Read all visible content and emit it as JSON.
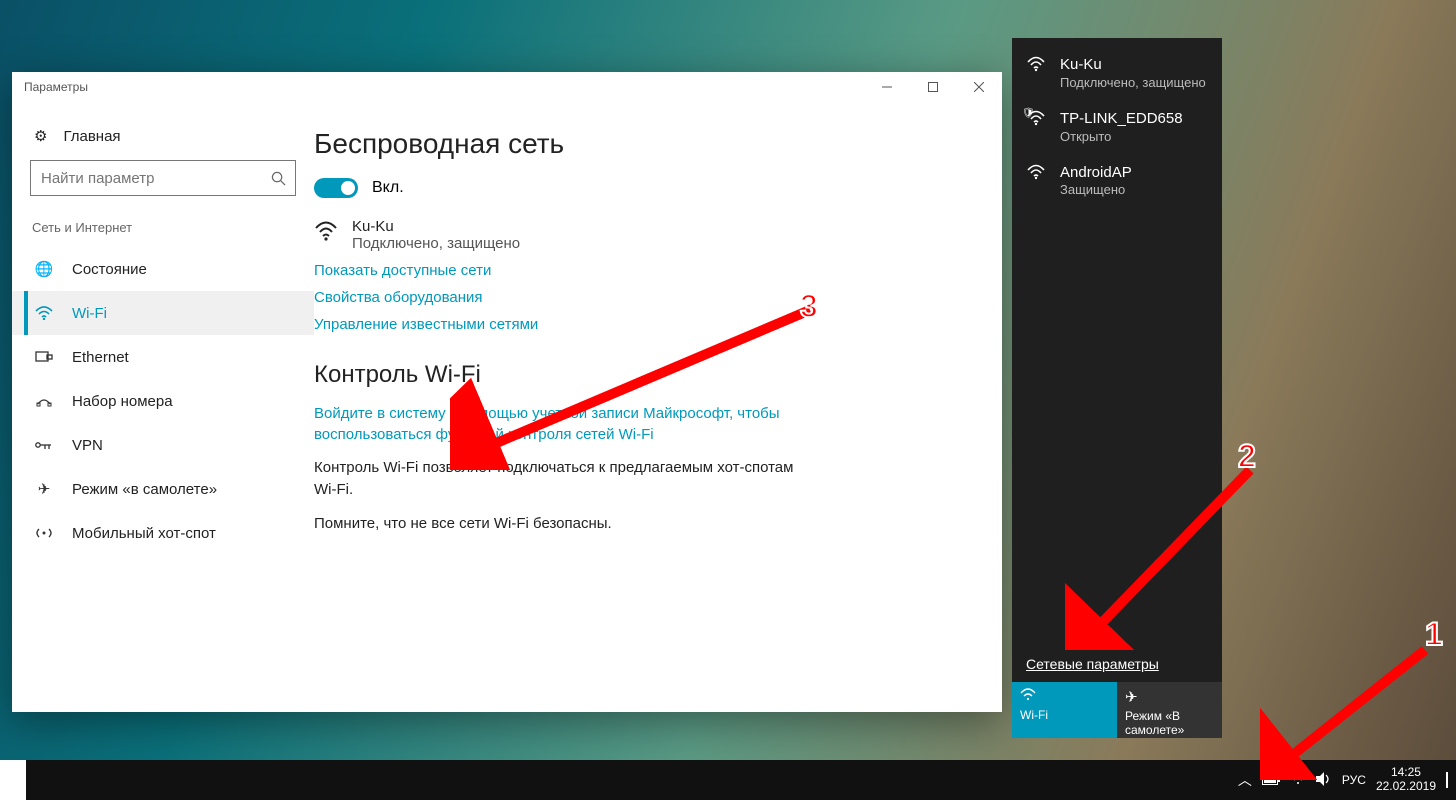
{
  "settings": {
    "window_title": "Параметры",
    "home_label": "Главная",
    "search_placeholder": "Найти параметр",
    "section_label": "Сеть и Интернет",
    "nav": {
      "status": "Состояние",
      "wifi": "Wi-Fi",
      "ethernet": "Ethernet",
      "dialup": "Набор номера",
      "vpn": "VPN",
      "airplane": "Режим «в самолете»",
      "hotspot": "Мобильный хот-спот"
    },
    "content": {
      "h1": "Беспроводная сеть",
      "toggle_label": "Вкл.",
      "net_name": "Ku-Ku",
      "net_status": "Подключено, защищено",
      "link_available": "Показать доступные сети",
      "link_hardware": "Свойства оборудования",
      "link_known": "Управление известными сетями",
      "h2": "Контроль Wi-Fi",
      "signin_link": "Войдите в систему с помощью учетной записи Майкрософт, чтобы воспользоваться функцией контроля сетей Wi-Fi",
      "body1": "Контроль Wi-Fi позволяет подключаться к предлагаемым хот-спотам Wi-Fi.",
      "body2": "Помните, что не все сети Wi-Fi безопасны."
    }
  },
  "flyout": {
    "networks": [
      {
        "name": "Ku-Ku",
        "status": "Подключено, защищено",
        "shield": false
      },
      {
        "name": "TP-LINK_EDD658",
        "status": "Открыто",
        "shield": true
      },
      {
        "name": "AndroidAP",
        "status": "Защищено",
        "shield": false
      }
    ],
    "settings_link": "Сетевые параметры",
    "tile_wifi": "Wi-Fi",
    "tile_plane": "Режим «В самолете»"
  },
  "taskbar": {
    "lang": "РУС",
    "time": "14:25",
    "date": "22.02.2019"
  },
  "annotations": {
    "n1": "1",
    "n2": "2",
    "n3": "3"
  }
}
